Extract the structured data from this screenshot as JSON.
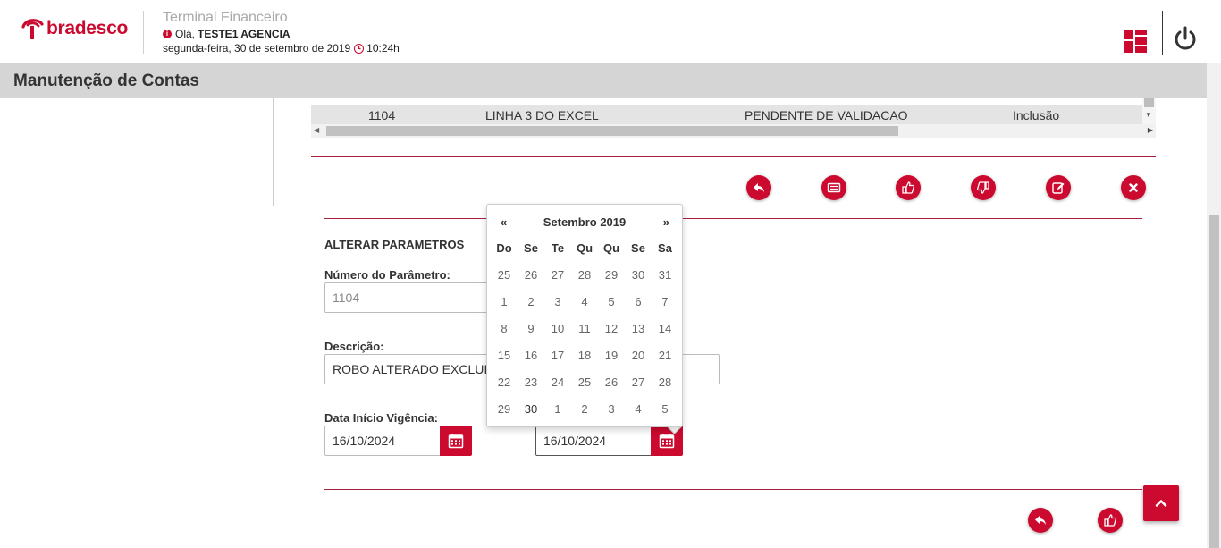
{
  "header": {
    "brand": "bradesco",
    "app_title": "Terminal Financeiro",
    "greeting_prefix": "Olá,",
    "user_name": "TESTE1 AGENCIA",
    "date_text": "segunda-feira, 30 de setembro de 2019",
    "time_text": "10:24h"
  },
  "page_title": "Manutenção de Contas",
  "table": {
    "row": [
      "1104",
      "LINHA 3 DO EXCEL",
      "PENDENTE DE VALIDACAO",
      "Inclusão"
    ]
  },
  "toolbar_icons": [
    "reply-icon",
    "list-card-icon",
    "thumbs-up-icon",
    "thumbs-down-icon",
    "edit-icon",
    "close-icon"
  ],
  "form": {
    "section_title": "ALTERAR PARAMETROS",
    "numero_label": "Número do Parâmetro:",
    "numero_value": "1104",
    "descricao_label": "Descrição:",
    "descricao_value": "ROBO ALTERADO EXCLUIR",
    "data_inicio_label": "Data Início Vigência:",
    "data_inicio_value": "16/10/2024",
    "data_fim_value": "16/10/2024"
  },
  "datepicker": {
    "prev": "«",
    "next": "»",
    "title": "Setembro 2019",
    "weekdays": [
      "Do",
      "Se",
      "Te",
      "Qu",
      "Qu",
      "Se",
      "Sa"
    ],
    "days": [
      "25",
      "26",
      "27",
      "28",
      "29",
      "30",
      "31",
      "1",
      "2",
      "3",
      "4",
      "5",
      "6",
      "7",
      "8",
      "9",
      "10",
      "11",
      "12",
      "13",
      "14",
      "15",
      "16",
      "17",
      "18",
      "19",
      "20",
      "21",
      "22",
      "23",
      "24",
      "25",
      "26",
      "27",
      "28",
      "29",
      "30",
      "1",
      "2",
      "3",
      "4",
      "5"
    ],
    "today": "30"
  },
  "colors": {
    "brand_red": "#cc092f",
    "title_bar": "#d5d5d5"
  }
}
